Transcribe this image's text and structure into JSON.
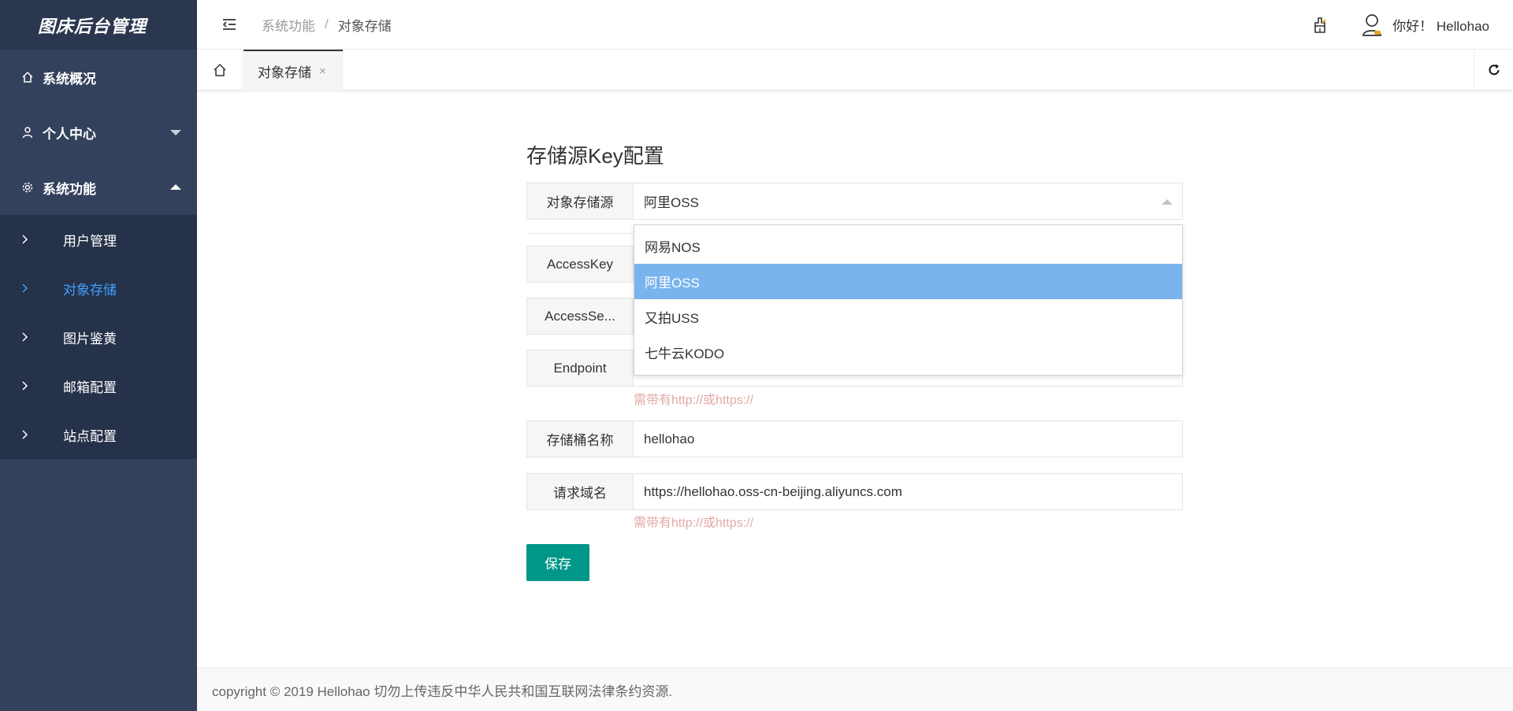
{
  "app": {
    "title": "图床后台管理"
  },
  "sidebar": {
    "items": [
      {
        "label": "系统概况",
        "icon": "home-icon"
      },
      {
        "label": "个人中心",
        "icon": "user-icon",
        "expanded": false
      },
      {
        "label": "系统功能",
        "icon": "gear-icon",
        "expanded": true
      }
    ],
    "submenu": [
      {
        "label": "用户管理",
        "active": false
      },
      {
        "label": "对象存储",
        "active": true
      },
      {
        "label": "图片鉴黄",
        "active": false
      },
      {
        "label": "邮箱配置",
        "active": false
      },
      {
        "label": "站点配置",
        "active": false
      }
    ],
    "active_color": "#3ea0ff"
  },
  "header": {
    "breadcrumb": {
      "parent": "系统功能",
      "separator": "/",
      "current": "对象存储"
    },
    "greeting": "你好！ Hellohao"
  },
  "tabs": {
    "active_label": "对象存储",
    "close_glyph": "×"
  },
  "form": {
    "title": "存储源Key配置",
    "storage_source": {
      "label": "对象存储源",
      "value": "阿里OSS"
    },
    "access_key": {
      "label": "AccessKey"
    },
    "access_secret": {
      "label": "AccessSe..."
    },
    "endpoint": {
      "label": "Endpoint",
      "hint": "需带有http://或https://"
    },
    "bucket": {
      "label": "存储桶名称",
      "value": "hellohao"
    },
    "domain": {
      "label": "请求域名",
      "value": "https://hellohao.oss-cn-beijing.aliyuncs.com",
      "hint": "需带有http://或https://"
    },
    "save_label": "保存"
  },
  "dropdown": {
    "options": [
      "网易NOS",
      "阿里OSS",
      "又拍USS",
      "七牛云KODO"
    ],
    "selected": "阿里OSS"
  },
  "footer": {
    "text": "copyright © 2019 Hellohao 切勿上传违反中华人民共和国互联网法律条约资源."
  },
  "colors": {
    "sidebar_bg": "#33415c",
    "primary_button": "#009688",
    "dropdown_selected": "#7ab4ee",
    "hint": "#e3a9a6"
  }
}
